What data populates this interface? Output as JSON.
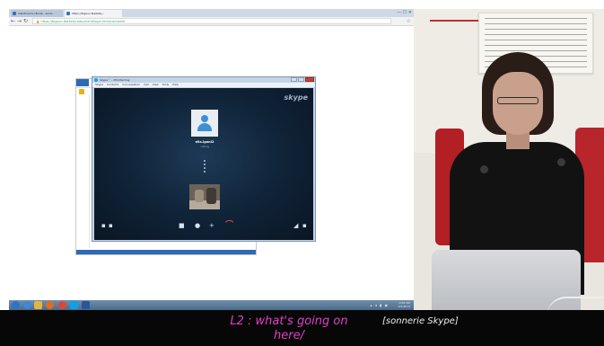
{
  "browser": {
    "tabs": [
      {
        "label": "Visioforums (Ecolé - sond..."
      },
      {
        "label": "https://bigsun.tbelietly..."
      }
    ],
    "url": "https://bigsun.tbelietly.edu/client/login.html/container",
    "window_controls": "— ☐ ✕"
  },
  "skype": {
    "title": "Skype™ - dfrimtechng",
    "menu": [
      "Skype",
      "Contacts",
      "Conversation",
      "Call",
      "View",
      "Tools",
      "Help"
    ],
    "brand": "skype",
    "callee": "elia.lgonI2",
    "status": "calling"
  },
  "taskbar": {
    "tray_time": "9:05 AM",
    "tray_date": "2/5/2014"
  },
  "subtitles": {
    "left": "L2 : what's going on here/",
    "right": "[sonnerie Skype]",
    "left_color": "#e040c8"
  },
  "icons": [
    "back-icon",
    "forward-icon",
    "refresh-icon",
    "lock-icon",
    "star-icon",
    "user-avatar-icon",
    "video-icon",
    "mic-icon",
    "add-icon",
    "end-call-icon",
    "start-icon",
    "ie-icon",
    "explorer-icon",
    "media-icon",
    "chrome-icon",
    "skype-icon",
    "word-icon"
  ]
}
